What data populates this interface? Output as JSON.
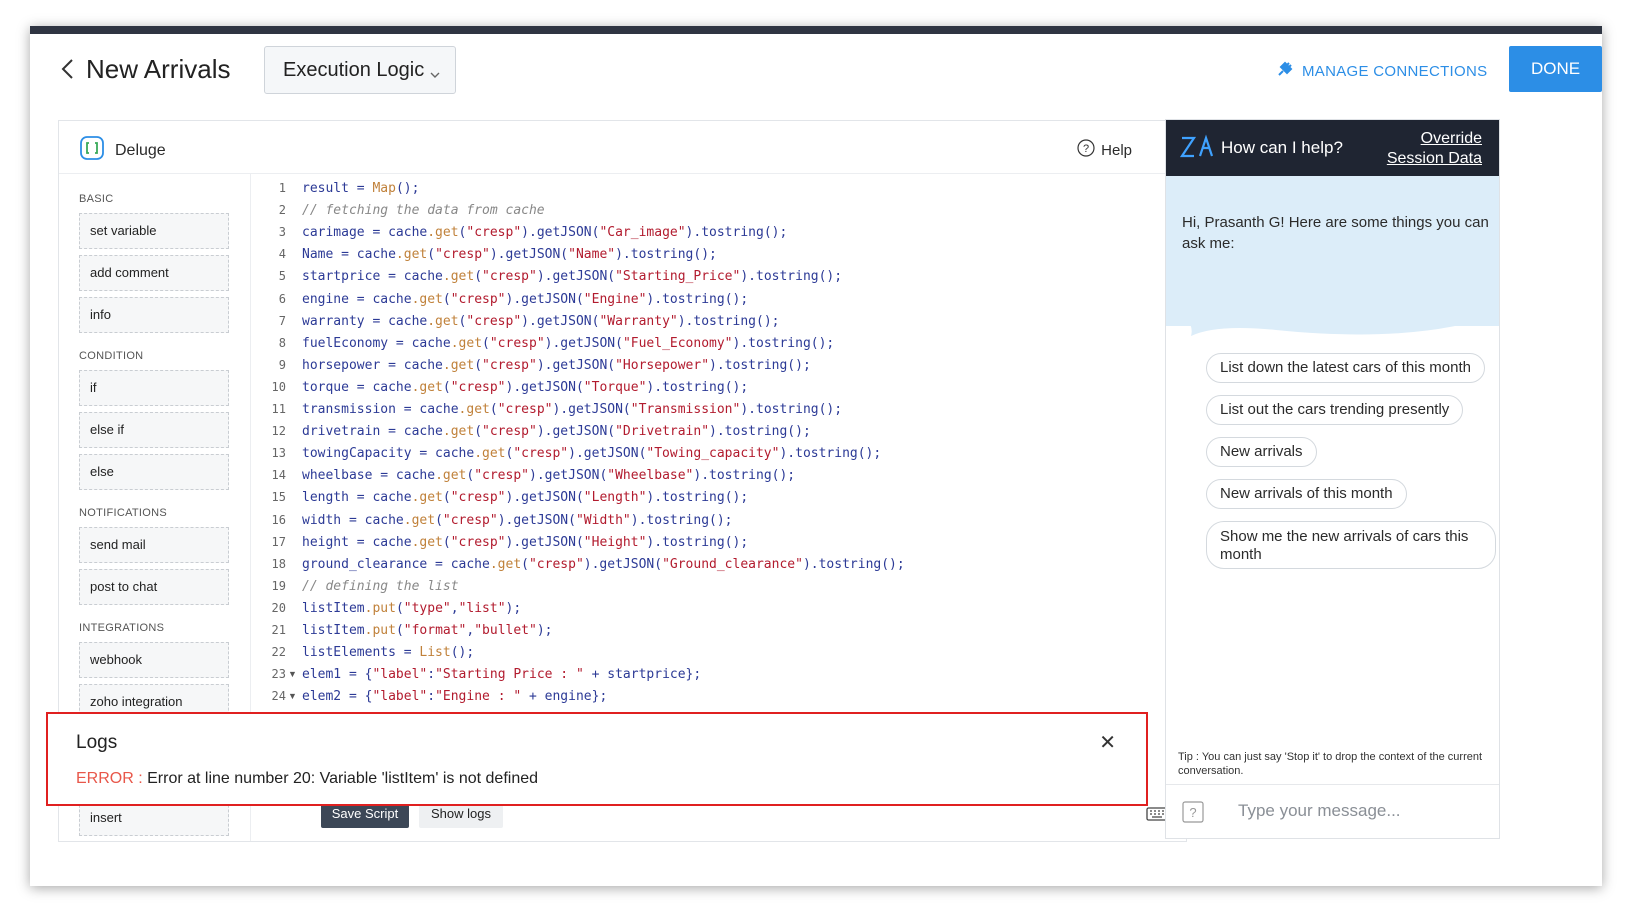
{
  "header": {
    "title": "New Arrivals",
    "dropdown_value": "Execution Logic",
    "manage_connections": "MANAGE CONNECTIONS",
    "done": "DONE"
  },
  "editor": {
    "language": "Deluge",
    "help": "Help",
    "save_script": "Save Script",
    "show_logs": "Show logs"
  },
  "sidebar": {
    "sections": [
      {
        "title": "BASIC",
        "items": [
          "set variable",
          "add comment",
          "info"
        ]
      },
      {
        "title": "CONDITION",
        "items": [
          "if",
          "else if",
          "else"
        ]
      },
      {
        "title": "NOTIFICATIONS",
        "items": [
          "send mail",
          "post to chat"
        ]
      },
      {
        "title": "INTEGRATIONS",
        "items": [
          "webhook",
          "zoho integration"
        ]
      }
    ],
    "extra_item": "insert"
  },
  "code_lines": [
    "result = Map();",
    "// fetching the data from cache",
    "carimage = cache.get(\"cresp\").getJSON(\"Car_image\").tostring();",
    "Name = cache.get(\"cresp\").getJSON(\"Name\").tostring();",
    "startprice = cache.get(\"cresp\").getJSON(\"Starting_Price\").tostring();",
    "engine = cache.get(\"cresp\").getJSON(\"Engine\").tostring();",
    "warranty = cache.get(\"cresp\").getJSON(\"Warranty\").tostring();",
    "fuelEconomy = cache.get(\"cresp\").getJSON(\"Fuel_Economy\").tostring();",
    "horsepower = cache.get(\"cresp\").getJSON(\"Horsepower\").tostring();",
    "torque = cache.get(\"cresp\").getJSON(\"Torque\").tostring();",
    "transmission = cache.get(\"cresp\").getJSON(\"Transmission\").tostring();",
    "drivetrain = cache.get(\"cresp\").getJSON(\"Drivetrain\").tostring();",
    "towingCapacity = cache.get(\"cresp\").getJSON(\"Towing_capacity\").tostring();",
    "wheelbase = cache.get(\"cresp\").getJSON(\"Wheelbase\").tostring();",
    "length = cache.get(\"cresp\").getJSON(\"Length\").tostring();",
    "width = cache.get(\"cresp\").getJSON(\"Width\").tostring();",
    "height = cache.get(\"cresp\").getJSON(\"Height\").tostring();",
    "ground_clearance = cache.get(\"cresp\").getJSON(\"Ground_clearance\").tostring();",
    "// defining the list",
    "listItem.put(\"type\",\"list\");",
    "listItem.put(\"format\",\"bullet\");",
    "listElements = List();",
    "elem1 = {\"label\":\"Starting Price : \" + startprice};",
    "elem2 = {\"label\":\"Engine : \" + engine};"
  ],
  "logs": {
    "title": "Logs",
    "error_label": "ERROR :",
    "message": "Error at line number 20: Variable 'listItem' is not defined"
  },
  "assistant": {
    "prompt": "How can I help?",
    "override_line1": "Override",
    "override_line2": "Session Data",
    "greeting": "Hi, Prasanth  G! Here are some things you can ask me:",
    "suggestions": [
      "List down the latest cars of this month",
      "List out the cars trending presently",
      "New arrivals",
      "New arrivals of this month",
      "Show me the new arrivals of cars this month"
    ],
    "tip": "Tip : You can just say 'Stop it' to drop the context of the current conversation.",
    "input_placeholder": "Type your message..."
  },
  "colors": {
    "accent": "#2c8ee6",
    "error": "#e8574a",
    "highlight_border": "#e02020",
    "assistant_header": "#1f2532"
  }
}
